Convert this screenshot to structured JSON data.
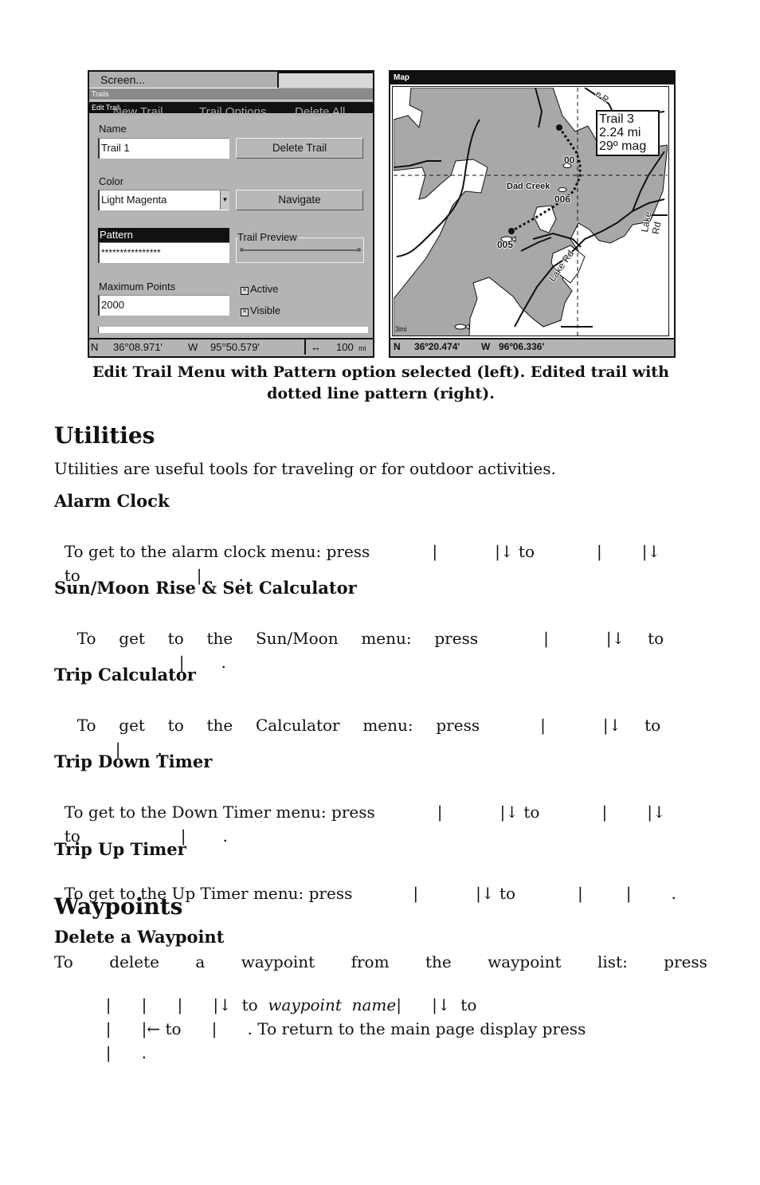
{
  "left_screen": {
    "menu_top": "Screen...",
    "trails_bar": "Trails",
    "edit_trail_bar": "Edit Trail",
    "ghost_buttons": [
      "New Trail",
      "Trail Options",
      "Delete All"
    ],
    "name_label": "Name",
    "name_value": "Trail 1",
    "delete_trail_button": "Delete Trail",
    "color_label": "Color",
    "color_value": "Light Magenta",
    "navigate_button": "Navigate",
    "pattern_label": "Pattern",
    "pattern_value": "****************",
    "trail_preview_label": "Trail Preview",
    "max_points_label": "Maximum Points",
    "max_points_value": "2000",
    "active_label": "Active",
    "active_checked": true,
    "visible_label": "Visible",
    "visible_checked": true,
    "checkbox_glyph": "✕",
    "status": {
      "lat_prefix": "N",
      "lat": "36°08.971'",
      "lon_prefix": "W",
      "lon": "95°50.579'",
      "zoom_icon": "↔",
      "zoom": "100",
      "zoom_unit": "mi"
    }
  },
  "right_screen": {
    "title": "Map",
    "info_box": [
      "Trail 3",
      "2.24 mi",
      "29º mag"
    ],
    "labels": {
      "dad_creek": "Dad Creek",
      "wp_006": "006",
      "wp_005": "005",
      "wp_00x": "00",
      "lake_rd_1": "Lake Rd",
      "lake_rd_2": "Lake Rd",
      "road_top": "e R"
    },
    "scale": "3mi",
    "status": {
      "lat_prefix": "N",
      "lat": "36º20.474'",
      "lon_prefix": "W",
      "lon": "96º06.336'"
    }
  },
  "caption": {
    "line1": "Edit Trail Menu with Pattern option selected (left). Edited trail with",
    "line2": "dotted line pattern (right)."
  },
  "sections": {
    "utilities": {
      "title": "Utilities",
      "intro": "Utilities are useful tools for traveling or for outdoor activities."
    },
    "alarm_clock": {
      "title": "Alarm Clock",
      "line1": [
        "To get to the alarm clock menu: press",
        "|",
        "|↓ to",
        "|",
        "|↓"
      ],
      "line2": [
        "to",
        "|",
        "."
      ]
    },
    "sun_moon": {
      "title": "Sun/Moon Rise & Set Calculator",
      "line1": [
        "To",
        "get",
        "to",
        "the",
        "Sun/Moon",
        "menu:",
        "press",
        "|",
        "|↓",
        "to"
      ],
      "line2": [
        "|",
        "."
      ]
    },
    "trip_calculator": {
      "title": "Trip Calculator",
      "line1": [
        "To",
        "get",
        "to",
        "the",
        "Calculator",
        "menu:",
        "press",
        "|",
        "|↓",
        "to"
      ],
      "line2": [
        "|",
        "."
      ]
    },
    "trip_down_timer": {
      "title": "Trip Down Timer",
      "line1": [
        "To get to the Down Timer menu: press",
        "|",
        "|↓ to",
        "|",
        "|↓"
      ],
      "line2": [
        "to",
        "|",
        "."
      ]
    },
    "trip_up_timer": {
      "title": "Trip Up Timer",
      "line1": [
        "To get to the Up Timer menu: press",
        "|",
        "|↓ to",
        "|",
        "|",
        "."
      ]
    },
    "waypoints": {
      "title": "Waypoints"
    },
    "delete_waypoint": {
      "title": "Delete a Waypoint",
      "line1": [
        "To",
        "delete",
        "a",
        "waypoint",
        "from",
        "the",
        "waypoint",
        "list:",
        "press"
      ],
      "line2_a": "|      |      |      |↓  to  ",
      "line2_italic": "waypoint  name",
      "line2_b": "|      |↓  to",
      "line3": [
        "|      |← to      |      . To return to the main page display press"
      ],
      "line4": [
        "|      ."
      ]
    }
  }
}
